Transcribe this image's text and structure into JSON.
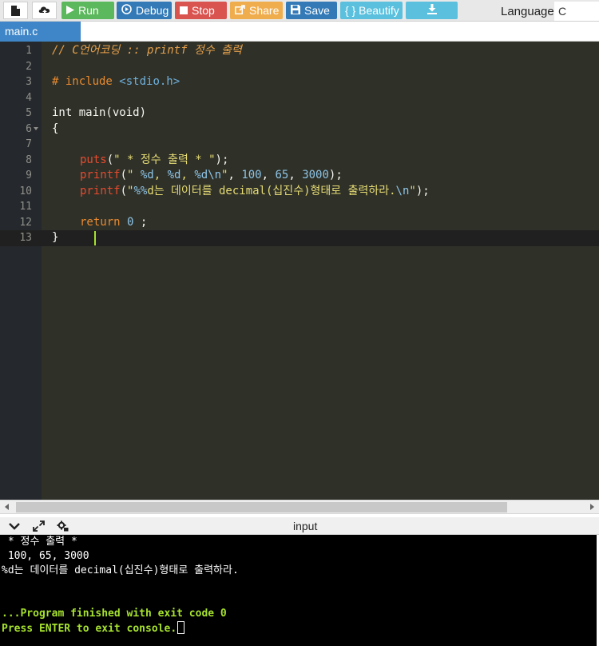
{
  "toolbar": {
    "new_file_icon": "file-icon",
    "upload_icon": "cloud-upload-icon",
    "run_label": "Run",
    "debug_label": "Debug",
    "stop_label": "Stop",
    "share_label": "Share",
    "save_label": "Save",
    "beautify_label": "{ } Beautify",
    "download_icon": "download-icon",
    "language_label": "Language",
    "language_value": "C"
  },
  "tabs": [
    {
      "label": "main.c",
      "active": true
    }
  ],
  "editor": {
    "line_numbers": [
      "1",
      "2",
      "3",
      "4",
      "5",
      "6",
      "7",
      "8",
      "9",
      "10",
      "11",
      "12",
      "13"
    ],
    "lines": {
      "l1": {
        "comment": "// C언어코딩 :: printf 정수 출력"
      },
      "l3": {
        "directive": "# include",
        "header": "<stdio.h>"
      },
      "l5": {
        "text": "int main(void)"
      },
      "l6": {
        "text": "{"
      },
      "l8": {
        "fn": "puts",
        "open": "(",
        "str": "\" * 정수 출력 * \"",
        "close": ");"
      },
      "l9": {
        "fn": "printf",
        "open": "(",
        "s1": "\" ",
        "f1": "%d",
        "s2": ", ",
        "f2": "%d",
        "s3": ", ",
        "f3": "%d",
        "esc": "\\n",
        "s4": "\"",
        "sep1": ", ",
        "n1": "100",
        "sep2": ", ",
        "n2": "65",
        "sep3": ", ",
        "n3": "3000",
        "close": ");"
      },
      "l10": {
        "fn": "printf",
        "open": "(",
        "s1": "\"",
        "pct": "%%",
        "s2": "d는 데이터를 decimal(십진수)형태로 출력하라.",
        "esc": "\\n",
        "s3": "\"",
        "close": ");"
      },
      "l12": {
        "kw": "return",
        "num": "0",
        "tail": " ;"
      },
      "l13": {
        "text": "}"
      }
    },
    "active_line": "13"
  },
  "console": {
    "title": "input",
    "icons": [
      "chevron-down-icon",
      "expand-icon",
      "settings-icon"
    ],
    "output": [
      " * 정수 출력 *",
      " 100, 65, 3000",
      "%d는 데이터를 decimal(십진수)형태로 출력하라.",
      "",
      "",
      "...Program finished with exit code 0",
      "Press ENTER to exit console."
    ]
  },
  "colors": {
    "run": "#5cb85c",
    "debug": "#337ab7",
    "stop": "#d9534f",
    "share": "#f0ad4e",
    "save": "#337ab7",
    "beautify": "#5bc0de",
    "editor_bg": "#2f3129",
    "console_bg": "#000000",
    "console_green": "#a6e22e"
  }
}
